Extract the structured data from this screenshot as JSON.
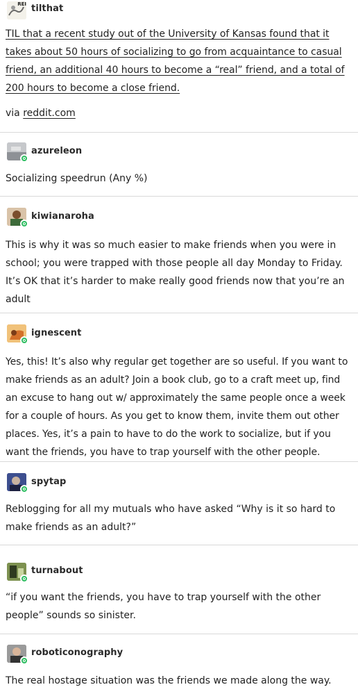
{
  "posts": [
    {
      "username": "tilthat",
      "avatar_icon": "reddit-til-logo-icon",
      "avatar_text": "REI",
      "text": "TIL that a recent study out of the University of Kansas found that it takes about 50 hours of socializing to go from acquaintance to casual friend, an additional 40 hours to become a “real” friend, and a total of 200 hours to become a close friend.",
      "via_prefix": "via ",
      "via_link": "reddit.com"
    },
    {
      "username": "azureleon",
      "avatar_icon": "user-avatar-icon",
      "text": "Socializing speedrun (Any %)"
    },
    {
      "username": "kiwianaroha",
      "avatar_icon": "user-avatar-icon",
      "text": "This is why it was so much easier to make friends when you were in school; you were trapped with those people all day Monday to Friday. It’s OK that it’s harder to make really good friends now that you’re an adult"
    },
    {
      "username": "ignescent",
      "avatar_icon": "user-avatar-icon",
      "text": "Yes, this! It’s also why regular get together are so useful. If you want to make friends as an adult? Join a book club, go to a craft meet up, find an excuse to hang out w/ approximately the same people once a week for a couple of hours. As you get to know them, invite them out other places. Yes, it’s a pain to have to do the work to socialize, but if you want the friends, you have to trap yourself with the other people."
    },
    {
      "username": "spytap",
      "avatar_icon": "user-avatar-icon",
      "text": "Reblogging for all my mutuals who have asked “Why is it so hard to make friends as an adult?”"
    },
    {
      "username": "turnabout",
      "avatar_icon": "user-avatar-icon",
      "text": "“if you want the friends, you have to trap yourself with the other people” sounds so sinister."
    },
    {
      "username": "roboticonography",
      "avatar_icon": "user-avatar-icon",
      "text": "The real hostage situation was the friends we made along the way."
    }
  ],
  "colors": {
    "badge": "#2bbd5f",
    "divider": "#d9d9d9",
    "text": "#222222"
  }
}
